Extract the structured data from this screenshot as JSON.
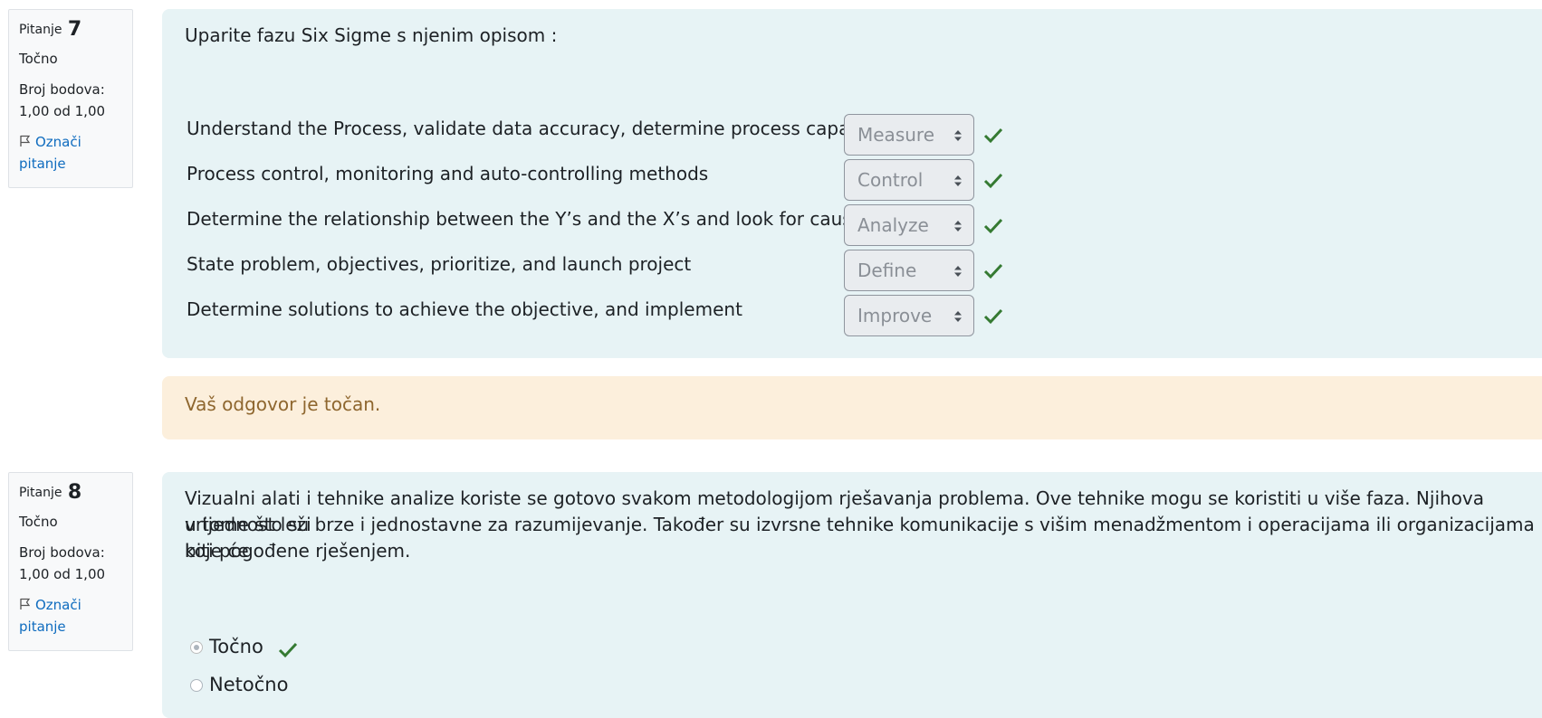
{
  "questions": [
    {
      "label": "Pitanje",
      "number": "7",
      "state": "Točno",
      "grade_label": "Broj bodova:",
      "grade_value": "1,00 od 1,00",
      "flag_label": "Označi pitanje",
      "text": "Uparite fazu Six Sigme s njenim opisom :",
      "matches": [
        {
          "description": "Understand the Process, validate data accuracy, determine process capability",
          "selected": "Measure"
        },
        {
          "description": "Process control, monitoring and auto-controlling methods",
          "selected": "Control"
        },
        {
          "description": "Determine the relationship between the Y’s and the X’s and look for causes",
          "selected": "Analyze"
        },
        {
          "description": "State problem, objectives, prioritize, and launch project",
          "selected": "Define"
        },
        {
          "description": "Determine solutions to achieve the objective, and implement",
          "selected": "Improve"
        }
      ],
      "feedback": "Vaš odgovor je točan."
    },
    {
      "label": "Pitanje",
      "number": "8",
      "state": "Točno",
      "grade_label": "Broj bodova:",
      "grade_value": "1,00 od 1,00",
      "flag_label": "Označi pitanje",
      "text_lines": [
        "Vizualni alati i tehnike analize koriste se gotovo svakom metodologijom rješavanja problema. Ove tehnike mogu se koristiti u više faza. Njihova vrijednost leži",
        "u tome što su brze i jednostavne za razumijevanje. Također su izvrsne tehnike komunikacije s višim menadžmentom i operacijama ili organizacijama koje će",
        "biti pogođene rješenjem."
      ],
      "options": [
        {
          "label": "Točno",
          "selected": true,
          "correct": true
        },
        {
          "label": "Netočno",
          "selected": false,
          "correct": false
        }
      ]
    }
  ],
  "colors": {
    "link": "#0f6cbf",
    "check": "#357a32",
    "content_bg": "#e7f3f5",
    "feedback_bg": "#fcefdc",
    "feedback_text": "#8e662e"
  },
  "icons": {
    "flag": "flag-icon",
    "check": "check-icon",
    "select_arrows": "select-arrows-icon"
  }
}
